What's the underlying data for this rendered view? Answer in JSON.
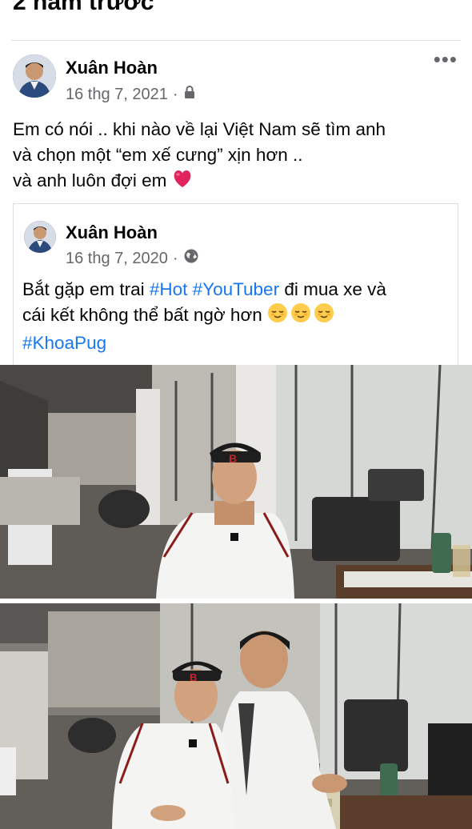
{
  "section_header": "2 năm trước",
  "post": {
    "author": "Xuân Hoàn",
    "date": "16 thg 7, 2021",
    "separator": "·",
    "privacy_icon": "lock-icon",
    "more_label": "•••",
    "text_lines": [
      "Em có nói .. khi nào về lại Việt Nam sẽ tìm anh",
      "và chọn một “em xế cưng” xịn hơn ..",
      "và anh luôn đợi em"
    ],
    "emoji": "red-heart-icon"
  },
  "shared_post": {
    "author": "Xuân Hoàn",
    "date": "16 thg 7, 2020",
    "separator": "·",
    "privacy_icon": "globe-icon",
    "line1_prefix": "Bắt gặp em trai ",
    "hashtag_hot": "#Hot",
    "hashtag_youtuber": "#YouTuber",
    "line1_suffix": " đi mua xe và",
    "line2": "cái kết không thể bất ngờ hơn ",
    "hashtag_khoapug": "#KhoaPug",
    "emoji": "relieved-face-icon"
  },
  "colors": {
    "hashtag": "#1877f2",
    "secondary_text": "#65676b",
    "heart": "#e0245e"
  }
}
